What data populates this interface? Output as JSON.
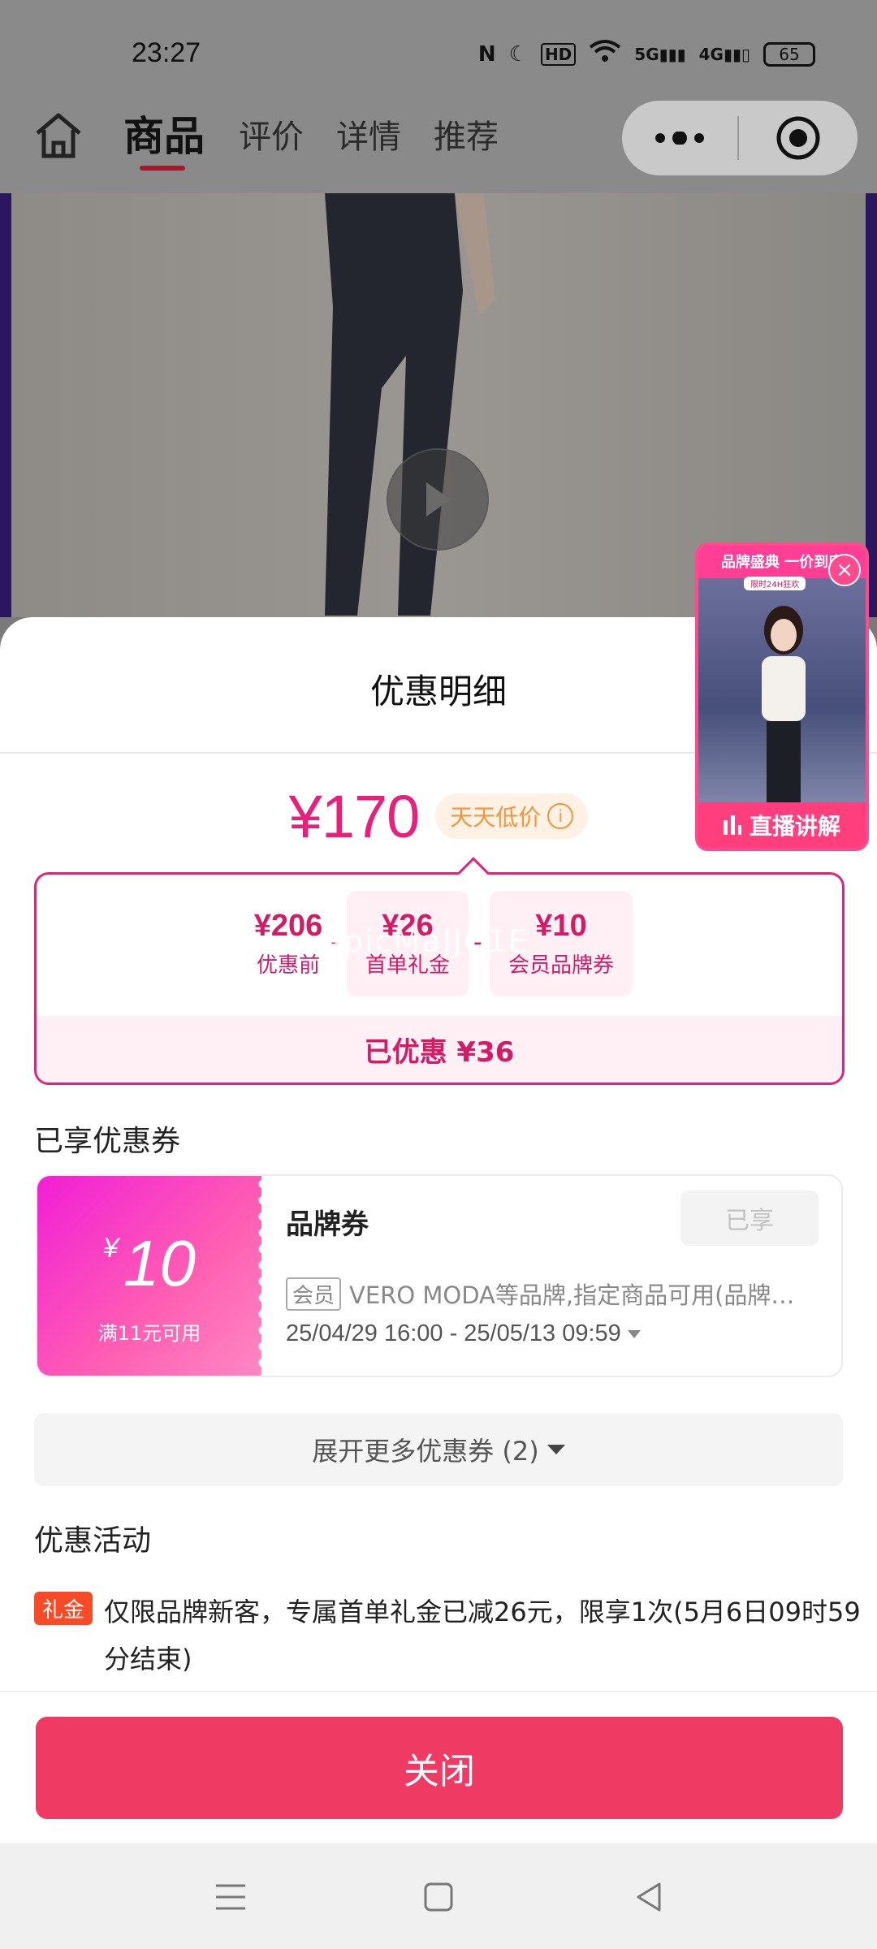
{
  "status_bar": {
    "time": "23:27",
    "icons": [
      "nfc-icon",
      "moon-icon",
      "hd-icon",
      "wifi-icon",
      "5g-signal-icon",
      "4g-signal-icon"
    ],
    "battery": "65"
  },
  "nav": {
    "tabs": [
      {
        "label": "商品",
        "active": true
      },
      {
        "label": "评价",
        "active": false
      },
      {
        "label": "详情",
        "active": false
      },
      {
        "label": "推荐",
        "active": false
      }
    ]
  },
  "live_float": {
    "banner": "品牌盛典 一价到底",
    "sub": "限时24H狂欢",
    "bottom_label": "直播讲解"
  },
  "sheet": {
    "title": "优惠明细",
    "final_price": "¥170",
    "price_tag": "天天低价",
    "calc": {
      "items": [
        {
          "value": "¥206",
          "label": "优惠前"
        },
        {
          "value": "¥26",
          "label": "首单礼金"
        },
        {
          "value": "¥10",
          "label": "会员品牌券"
        }
      ],
      "ops": [
        "-",
        "-"
      ],
      "watermark": "ApicMaJJC1E",
      "saved": "已优惠 ¥36"
    },
    "coupons_title": "已享优惠券",
    "coupon": {
      "currency": "¥",
      "amount": "10",
      "condition": "满11元可用",
      "name": "品牌券",
      "status": "已享",
      "member_tag": "会员",
      "desc": "VERO MODA等品牌,指定商品可用(品牌…",
      "date": "25/04/29 16:00 - 25/05/13 09:59"
    },
    "expand_label": "展开更多优惠券 (2)",
    "activities_title": "优惠活动",
    "activity": {
      "tag": "礼金",
      "text": "仅限品牌新客，专属首单礼金已减26元，限享1次(5月6日09时59分结束)"
    },
    "close_label": "关闭"
  },
  "colors": {
    "accent": "#e8207b",
    "close_button": "#ef3a64",
    "gift_tag": "#f74a26"
  }
}
